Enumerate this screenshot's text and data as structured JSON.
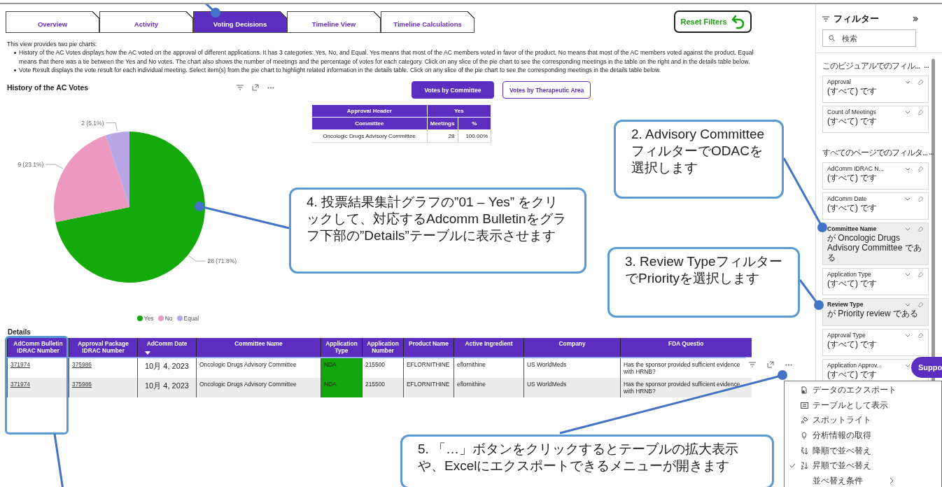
{
  "tabs": [
    {
      "label": "Overview",
      "selected": false
    },
    {
      "label": "Activity",
      "selected": false
    },
    {
      "label": "Voting Decisions",
      "selected": true
    },
    {
      "label": "Timeline View",
      "selected": false
    },
    {
      "label": "Timeline Calculations",
      "selected": false
    }
  ],
  "reset_button": {
    "label": "Reset Filters"
  },
  "description": {
    "intro": "This view provides two pie charts:",
    "bullets": [
      "History of the AC Votes displays how the AC voted on the approval of different applications. It has 3 categories: Yes, No, and Equal. Yes means that most of the AC members voted in favor of the product. No means that most of the AC members voted against the product. Equal means that there was a tie between the Yes and No votes. The chart also shows the number of meetings and the percentage of votes for each category. Click on any slice of the pie chart to see the corresponding meetings in the table on the right and in the details table below.",
      "Vote Result displays the vote result for each individual meeting. Select item(s) from the pie chart to highlight related information in the details table. Click on any slice of the pie chart to see the corresponding meetings in the details table below."
    ]
  },
  "vote_chart": {
    "chart_data": {
      "type": "pie",
      "title": "History of the AC Votes",
      "categories": [
        "Yes",
        "No",
        "Equal"
      ],
      "values": [
        28,
        9,
        2
      ],
      "colors": [
        "#14aa0c",
        "#ec98c0",
        "#b8a9e6"
      ],
      "data_labels": true,
      "value_labels": [
        "28 (71.8%)",
        "9 (23.1%)",
        "2 (5.1%)"
      ]
    }
  },
  "view_buttons": [
    {
      "label": "Votes by Committee",
      "selected": true
    },
    {
      "label": "Votes by Therapeutic Area",
      "selected": false
    }
  ],
  "summary_table": {
    "group_header": "Approval Header",
    "group_value": "Yes",
    "columns": [
      "Committee",
      "Meetings",
      "%"
    ],
    "rows": [
      [
        "Oncologic Drugs Advisory Committee",
        "28",
        "100.00%"
      ]
    ]
  },
  "details": {
    "title": "Details",
    "columns": [
      {
        "label": "AdComm Bulletin IDRAC Number",
        "kind": "link",
        "sorted": false
      },
      {
        "label": "Approval Package IDRAC Number",
        "kind": "link",
        "sorted": false
      },
      {
        "label": "AdComm Date",
        "kind": "date",
        "sorted": true
      },
      {
        "label": "Committee Name",
        "kind": "text",
        "sorted": false
      },
      {
        "label": "Application Type",
        "kind": "colored",
        "sorted": false
      },
      {
        "label": "Application Number",
        "kind": "text",
        "sorted": false
      },
      {
        "label": "Product Name",
        "kind": "text",
        "sorted": false
      },
      {
        "label": "Active Ingredient",
        "kind": "text",
        "sorted": false
      },
      {
        "label": "Company",
        "kind": "text",
        "sorted": false
      },
      {
        "label": "FDA Questio",
        "kind": "text",
        "sorted": false
      }
    ],
    "rows": [
      {
        "shaded": false,
        "color": "#13a60a",
        "cells": [
          "371974",
          "375986",
          "10月 4, 2023",
          "Oncologic Drugs Advisory Committee",
          "NDA",
          "215500",
          "EFLORNITHINE",
          "eflornithine",
          "US WorldMeds",
          "Has the sponsor provided sufficient evidence with HRNB?"
        ]
      },
      {
        "shaded": true,
        "color": "#13a60a",
        "cells": [
          "371974",
          "375986",
          "10月 4, 2023",
          "Oncologic Drugs Advisory Committee",
          "NDA",
          "215500",
          "EFLORNITHINE",
          "eflornithine",
          "US WorldMeds",
          "Has the sponsor provided sufficient evidence with HRNB?"
        ]
      }
    ]
  },
  "filters_pane": {
    "title": "フィルター",
    "search_placeholder": "検索",
    "sections": [
      {
        "title": "このビジュアルでのフィル...",
        "more": "...",
        "cards": [
          {
            "title": "Approval",
            "value": "(すべて) です",
            "applied": false
          },
          {
            "title": "Count of Meetings",
            "value": "(すべて) です",
            "applied": false
          }
        ]
      },
      {
        "title": "すべてのページでのフィルタ...",
        "more": "...",
        "cards": [
          {
            "title": "AdComm IDRAC N...",
            "value": "(すべて) です",
            "applied": false
          },
          {
            "title": "AdComm Date",
            "value": "(すべて) です",
            "applied": false
          },
          {
            "title": "Committee Name",
            "value": "が Oncologic Drugs Advisory Committee である",
            "applied": true
          },
          {
            "title": "Application Type",
            "value": "(すべて) です",
            "applied": false
          },
          {
            "title": "Review Type",
            "value": "が Priority review である",
            "applied": true
          },
          {
            "title": "Approval Type",
            "value": "(すべて) です",
            "applied": false
          },
          {
            "title": "Application Approv...",
            "value": "(すべて) です",
            "applied": false
          }
        ]
      }
    ]
  },
  "context_menu": {
    "items": [
      {
        "label": "データのエクスポート",
        "checked": false,
        "submenu": false
      },
      {
        "label": "テーブルとして表示",
        "checked": false,
        "submenu": false
      },
      {
        "label": "スポットライト",
        "checked": false,
        "submenu": false
      },
      {
        "label": "分析情報の取得",
        "checked": false,
        "submenu": false
      },
      {
        "label": "降順で並べ替え",
        "checked": false,
        "submenu": false
      },
      {
        "label": "昇順で並べ替え",
        "checked": true,
        "submenu": false
      },
      {
        "label": "並べ替え条件",
        "checked": false,
        "submenu": true
      }
    ]
  },
  "support_button": {
    "label": "Suppo"
  },
  "callouts": [
    {
      "text": "2. Advisory CommitteeフィルターでODACを選択します"
    },
    {
      "text": "3. Review TypeフィルターでPriorityを選択します"
    },
    {
      "text": "4. 投票結果集計グラフの”01 – Yes” をクリックして、対応するAdcomm Bulletinをグラフ下部の”Details”テーブルに表示させます"
    },
    {
      "text": "5. 「…」ボタンをクリックするとテーブルの拡大表示や、Excelにエクスポートできるメニューが開きます"
    }
  ]
}
